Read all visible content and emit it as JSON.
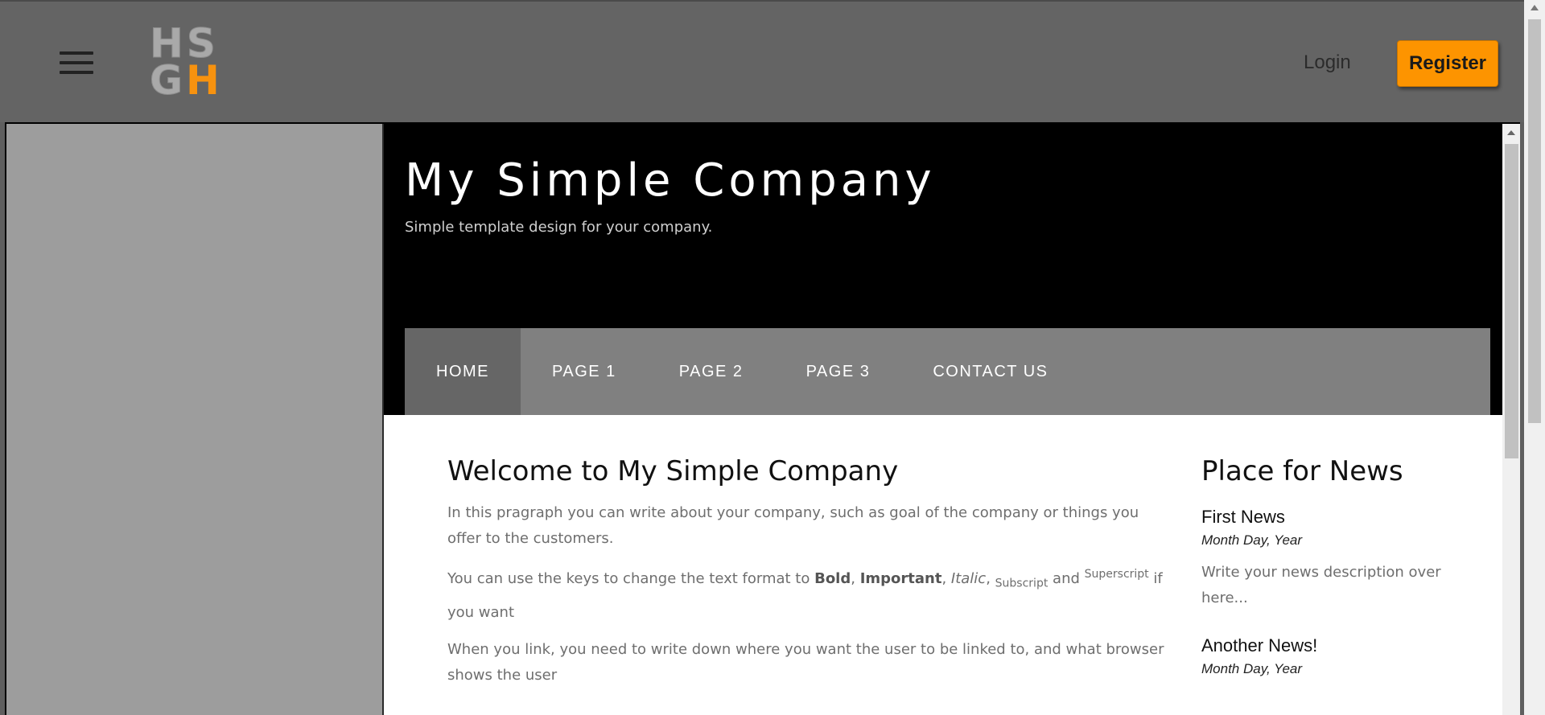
{
  "header": {
    "logo": {
      "row1": "HS",
      "row2_gray": "G",
      "row2_orange": "H"
    },
    "login_label": "Login",
    "register_label": "Register"
  },
  "site": {
    "title": "My Simple Company",
    "subtitle": "Simple template design for your company.",
    "nav": [
      {
        "label": "HOME",
        "active": true
      },
      {
        "label": "PAGE 1",
        "active": false
      },
      {
        "label": "PAGE 2",
        "active": false
      },
      {
        "label": "PAGE 3",
        "active": false
      },
      {
        "label": "CONTACT US",
        "active": false
      }
    ],
    "main": {
      "heading": "Welcome to My Simple Company",
      "p1": "In this pragraph you can write about your company, such as goal of the company or things you offer to the customers.",
      "p2": {
        "before": "You can use the keys to change the text format to ",
        "bold": "Bold",
        "comma1": ", ",
        "important": "Important",
        "comma2": ", ",
        "italic": "Italic",
        "comma3": ", ",
        "subscript": "Subscript",
        "and": " and ",
        "superscript": "Superscript",
        "after": " if you want"
      },
      "p3": "When you link, you need to write down where you want the user to be linked to, and what browser shows the user"
    },
    "news": {
      "heading": "Place for News",
      "items": [
        {
          "title": "First News",
          "date": "Month Day, Year",
          "desc": "Write your news description over here..."
        },
        {
          "title": "Another News!",
          "date": "Month Day, Year"
        }
      ]
    }
  },
  "colors": {
    "accent": "#fd9400",
    "header_bg": "#646464",
    "nav_bg": "#808080",
    "nav_active_bg": "#666666"
  }
}
